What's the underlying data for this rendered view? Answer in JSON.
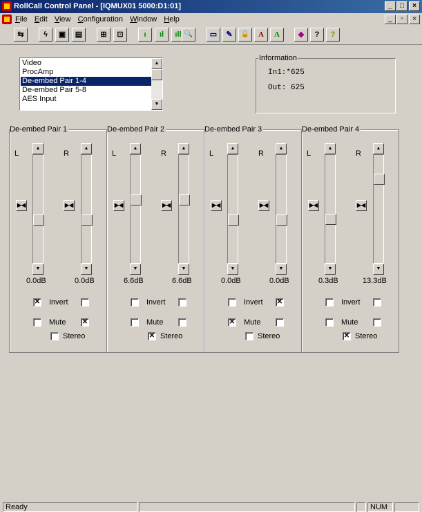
{
  "window": {
    "title": "RollCall Control Panel - [IQMUX01 5000:D1:01]",
    "buttons": {
      "minimize": "_",
      "maximize": "□",
      "close": "×"
    }
  },
  "menu": {
    "items": [
      "File",
      "Edit",
      "View",
      "Configuration",
      "Window",
      "Help"
    ],
    "mdi_buttons": {
      "minimize": "_",
      "restore": "▫",
      "close": "×"
    }
  },
  "toolbar": {
    "buttons": [
      {
        "icon": "connect-icon",
        "glyph": "⇆"
      },
      {
        "icon": "lightning-icon",
        "glyph": "ϟ"
      },
      {
        "icon": "save-icon",
        "glyph": "▣"
      },
      {
        "icon": "save-all-icon",
        "glyph": "▤"
      },
      {
        "icon": "network-icon",
        "glyph": "⊞"
      },
      {
        "icon": "device-icon",
        "glyph": "⊡"
      },
      {
        "icon": "level-low-icon",
        "glyph": "ı"
      },
      {
        "icon": "level-mid-icon",
        "glyph": "ıl"
      },
      {
        "icon": "level-high-icon",
        "glyph": "ıll"
      },
      {
        "icon": "search-icon",
        "glyph": "🔍"
      },
      {
        "icon": "book-icon",
        "glyph": "▭"
      },
      {
        "icon": "edit-icon",
        "glyph": "✎"
      },
      {
        "icon": "lock-icon",
        "glyph": "🔒"
      },
      {
        "icon": "font-a-icon",
        "glyph": "A"
      },
      {
        "icon": "font-a-green-icon",
        "glyph": "A"
      },
      {
        "icon": "eraser-icon",
        "glyph": "◆"
      },
      {
        "icon": "help-dialog-icon",
        "glyph": "?"
      },
      {
        "icon": "help-icon",
        "glyph": "?"
      }
    ]
  },
  "list": {
    "items": [
      "Video",
      "ProcAmp",
      "De-embed Pair 1-4",
      "De-embed Pair 5-8",
      "AES Input"
    ],
    "selected_index": 2
  },
  "information": {
    "legend": "Information",
    "in_line": "In1:*625",
    "out_line": "Out: 625"
  },
  "pairs": [
    {
      "title": "De-embed Pair 1",
      "left_label": "L",
      "right_label": "R",
      "left_db": "0.0dB",
      "right_db": "0.0dB",
      "left_level": 0.0,
      "right_level": 0.0,
      "invert_left": true,
      "invert_right": false,
      "invert_label": "Invert",
      "mute_left": false,
      "mute_right": true,
      "mute_label": "Mute",
      "stereo": false,
      "stereo_label": "Stereo"
    },
    {
      "title": "De-embed Pair 2",
      "left_label": "L",
      "right_label": "R",
      "left_db": "6.6dB",
      "right_db": "6.6dB",
      "left_level": 6.6,
      "right_level": 6.6,
      "invert_left": false,
      "invert_right": false,
      "invert_label": "Invert",
      "mute_left": false,
      "mute_right": false,
      "mute_label": "Mute",
      "stereo": true,
      "stereo_label": "Stereo"
    },
    {
      "title": "De-embed Pair 3",
      "left_label": "L",
      "right_label": "R",
      "left_db": "0.0dB",
      "right_db": "0.0dB",
      "left_level": 0.0,
      "right_level": 0.0,
      "invert_left": false,
      "invert_right": true,
      "invert_label": "Invert",
      "mute_left": true,
      "mute_right": false,
      "mute_label": "Mute",
      "stereo": false,
      "stereo_label": "Stereo"
    },
    {
      "title": "De-embed Pair 4",
      "left_label": "L",
      "right_label": "R",
      "left_db": "0.3dB",
      "right_db": "13.3dB",
      "left_level": 0.3,
      "right_level": 13.3,
      "invert_left": false,
      "invert_right": false,
      "invert_label": "Invert",
      "mute_left": false,
      "mute_right": false,
      "mute_label": "Mute",
      "stereo": true,
      "stereo_label": "Stereo"
    }
  ],
  "status": {
    "text": "Ready",
    "num": "NUM"
  }
}
